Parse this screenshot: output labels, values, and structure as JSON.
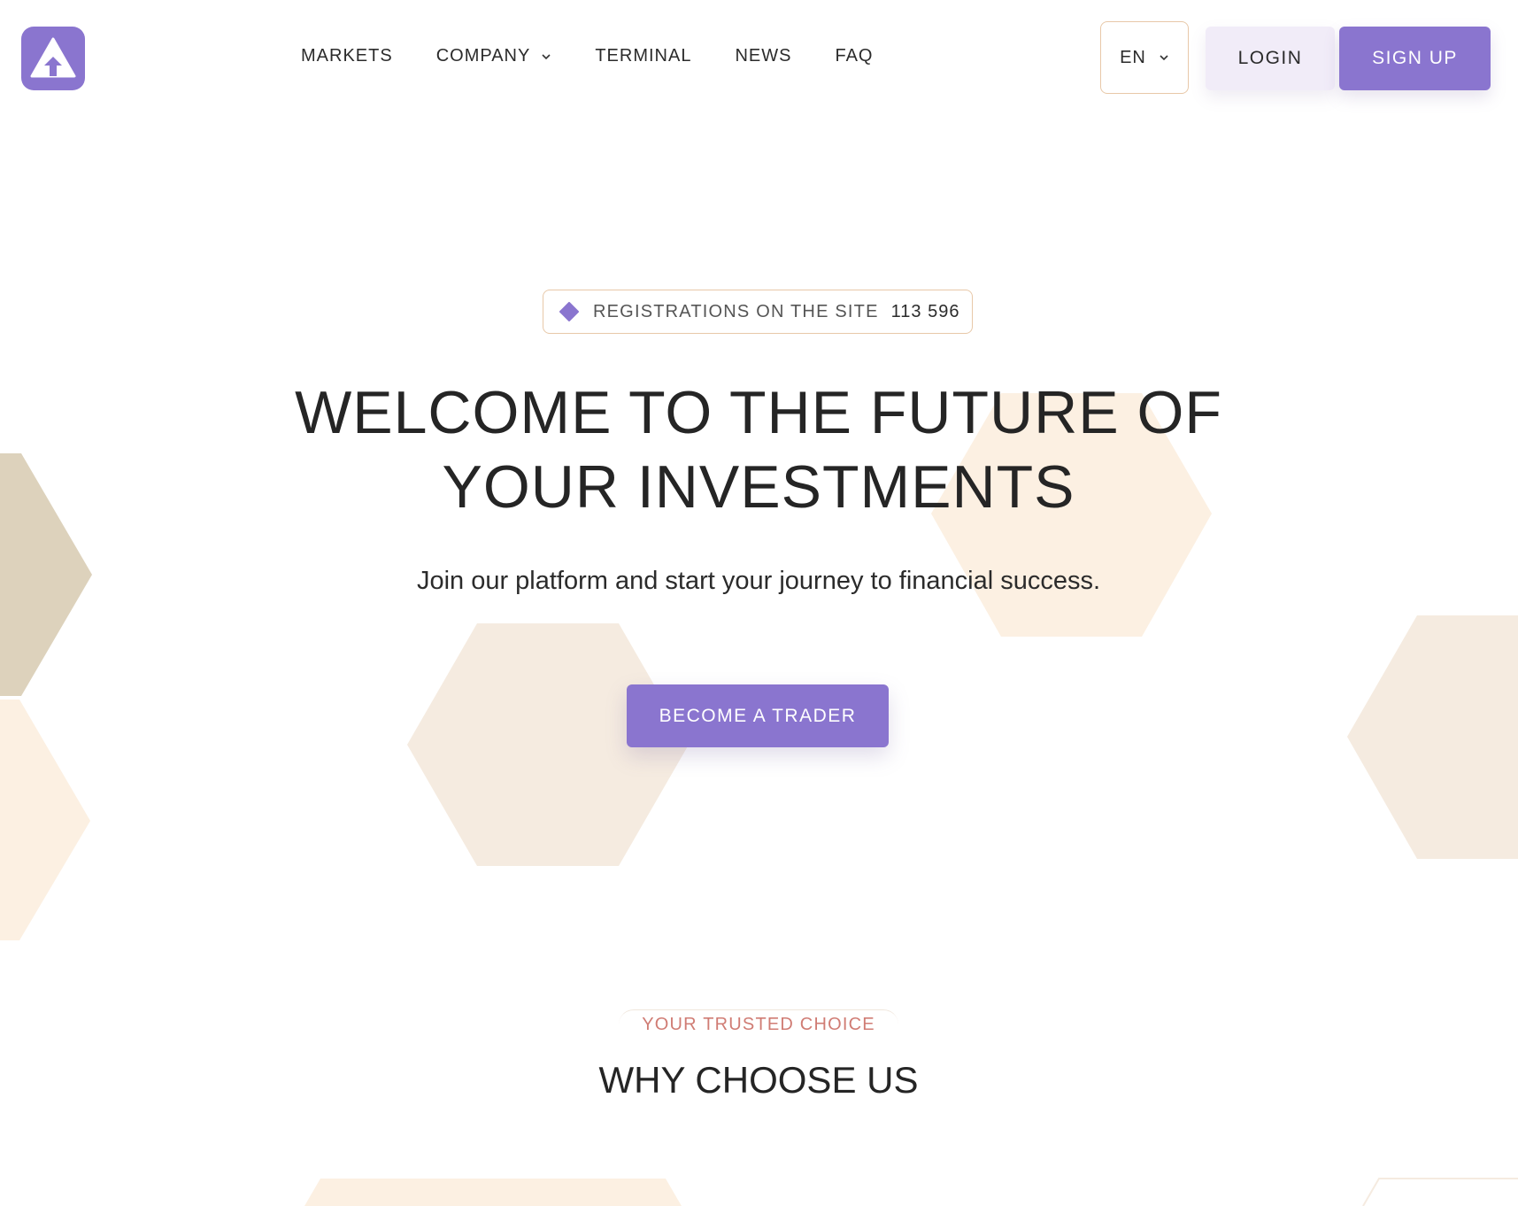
{
  "colors": {
    "accent": "#8a75cf",
    "accent_light": "#f1ecf8",
    "badge_border": "#e8c8a8",
    "tag_text": "#d07c74",
    "hex_light": "#fcf0e2",
    "hex_mid": "#f5ebe0",
    "hex_dark": "#ddd2bc"
  },
  "header": {
    "logo_icon": "arrow-up-triangle-icon",
    "nav": [
      {
        "label": "MARKETS"
      },
      {
        "label": "COMPANY",
        "has_dropdown": true
      },
      {
        "label": "TERMINAL"
      },
      {
        "label": "NEWS"
      },
      {
        "label": "FAQ"
      }
    ],
    "language": "EN",
    "login_label": "LOGIN",
    "signup_label": "SIGN UP"
  },
  "hero": {
    "registrations_label": "REGISTRATIONS ON THE SITE",
    "registrations_count": "113 596",
    "title_line1": "WELCOME TO THE FUTURE OF",
    "title_line2": "YOUR INVESTMENTS",
    "subtitle": "Join our platform and start your journey to financial success.",
    "cta_label": "BECOME A TRADER"
  },
  "why": {
    "tag": "YOUR TRUSTED CHOICE",
    "title": "WHY CHOOSE US"
  }
}
